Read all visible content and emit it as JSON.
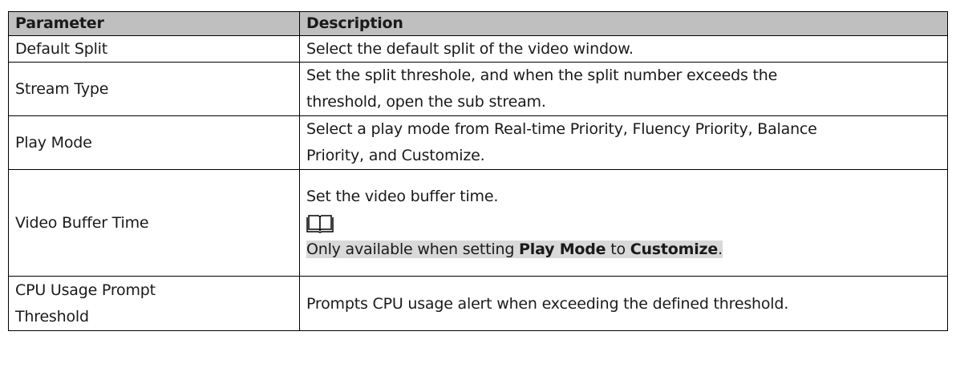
{
  "table": {
    "headers": [
      "Parameter",
      "Description"
    ],
    "rows": [
      {
        "parameter": "Default Split",
        "description": "Select the default split of the video window."
      },
      {
        "parameter": "Stream Type",
        "description_lines": [
          "Set the split threshole, and when the split number exceeds the",
          "threshold, open the sub stream."
        ]
      },
      {
        "parameter": "Play Mode",
        "description_lines": [
          "Select a play mode from Real-time Priority, Fluency Priority, Balance",
          "Priority, and Customize."
        ]
      },
      {
        "parameter": "Video Buffer Time",
        "description": "Set the video buffer time.",
        "note_icon": "note-book-icon",
        "note": {
          "prefix": "Only available when setting ",
          "bold1": "Play Mode",
          "middle": " to ",
          "bold2": "Customize",
          "suffix": "."
        }
      },
      {
        "parameter_lines": [
          "CPU Usage Prompt",
          "Threshold"
        ],
        "description": "Prompts CPU usage alert when exceeding the defined threshold."
      }
    ]
  },
  "colors": {
    "header_bg": "#bfbfbf",
    "note_highlight": "#d9d9d9",
    "border": "#000000"
  }
}
